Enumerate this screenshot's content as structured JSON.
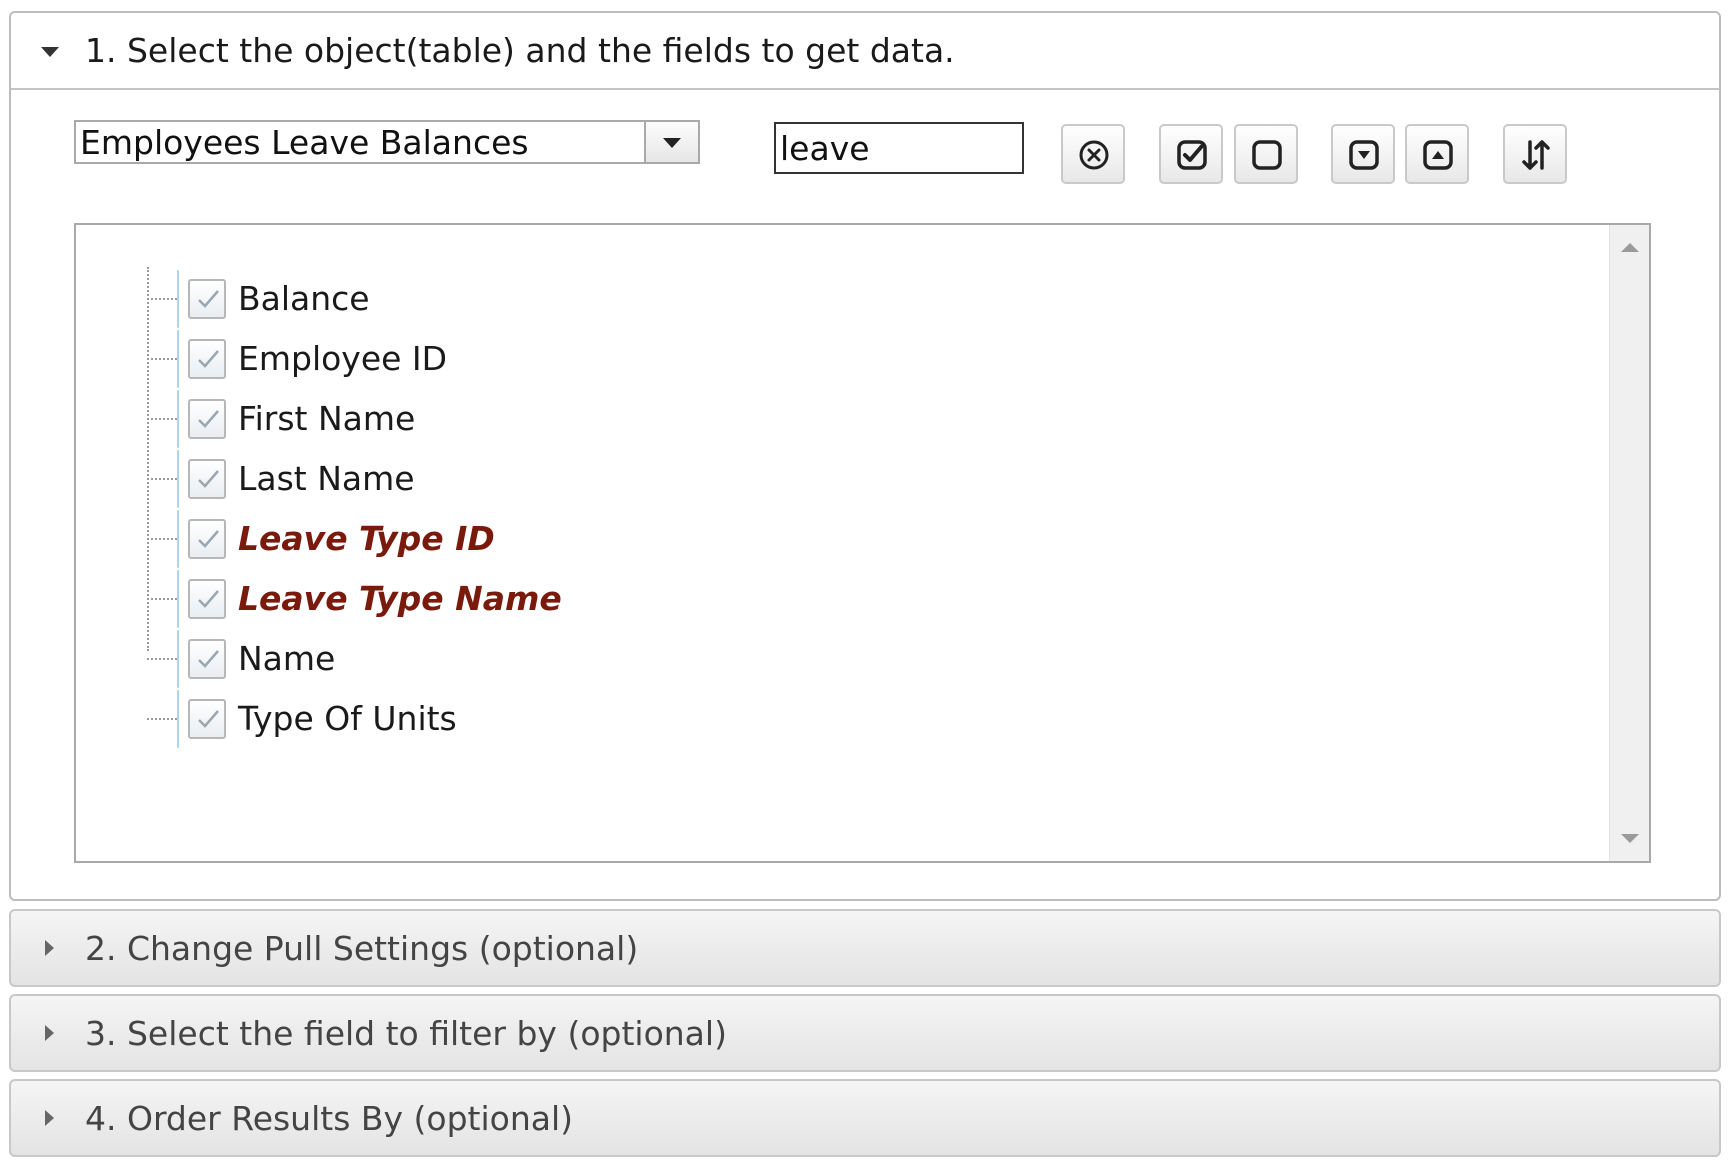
{
  "sections": [
    {
      "title": "1. Select the object(table) and the fields to get data.",
      "expanded": true
    },
    {
      "title": "2. Change Pull Settings (optional)",
      "expanded": false
    },
    {
      "title": "3. Select the field to filter by (optional)",
      "expanded": false
    },
    {
      "title": "4. Order Results By (optional)",
      "expanded": false
    }
  ],
  "object_select": {
    "value": "Employees Leave Balances"
  },
  "search": {
    "value": "leave"
  },
  "toolbar": {
    "buttons": [
      {
        "name": "clear-search-button",
        "icon": "circle-x-icon"
      },
      {
        "name": "check-all-button",
        "icon": "check-square-icon"
      },
      {
        "name": "uncheck-all-button",
        "icon": "square-icon"
      },
      {
        "name": "expand-all-button",
        "icon": "square-caret-down-icon"
      },
      {
        "name": "collapse-all-button",
        "icon": "square-caret-up-icon"
      },
      {
        "name": "sort-button",
        "icon": "sort-arrows-icon"
      }
    ]
  },
  "fields": [
    {
      "label": "Balance",
      "checked": true,
      "key": false
    },
    {
      "label": "Employee ID",
      "checked": true,
      "key": false
    },
    {
      "label": "First Name",
      "checked": true,
      "key": false
    },
    {
      "label": "Last Name",
      "checked": true,
      "key": false
    },
    {
      "label": "Leave Type ID",
      "checked": true,
      "key": true
    },
    {
      "label": "Leave Type Name",
      "checked": true,
      "key": true
    },
    {
      "label": "Name",
      "checked": true,
      "key": false
    },
    {
      "label": "Type Of Units",
      "checked": true,
      "key": false
    }
  ],
  "colors": {
    "node_bg": "#cce8fb",
    "key_field_text": "#7a1a0c"
  }
}
